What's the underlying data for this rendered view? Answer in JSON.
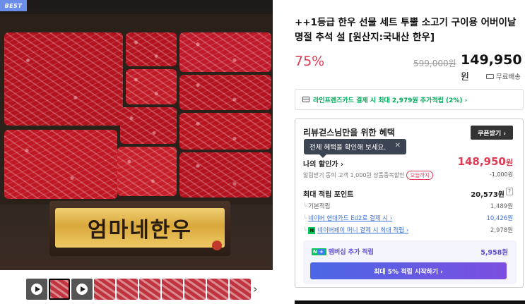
{
  "hero": {
    "badge": "BEST",
    "plaque_text": "엄마네한우"
  },
  "thumbnails": {
    "count": 10,
    "selected_index": 1,
    "video_indices": [
      0,
      2
    ],
    "next_label": "›"
  },
  "product": {
    "title": "++1등급 한우 선물 세트 투뿔 소고기 구이용 어버이날 명절 추석 설 [원산지:국내산 한우]",
    "discount_rate": "75%",
    "original_price": "599,000원",
    "sale_price": "149,950",
    "sale_unit": "원",
    "shipping": "무료배송"
  },
  "card_promo": {
    "text": "라인프렌즈카드 결제 시 최대 2,979원 추가적립 (2%) ›"
  },
  "benefit": {
    "heading": "리뷰걷스님만을 위한 혜택",
    "coupon_button": "쿠폰받기 ›",
    "tooltip": "전체 혜택을 확인해 보세요.",
    "tooltip_close": "✕",
    "my_price_label": "나의 할인가 ›",
    "my_price": "148,950",
    "my_price_unit": "원",
    "alarm_text": "알림받기 동의 고객 1,000원 상품중복할인",
    "alarm_tag": "오늘까지",
    "alarm_amount": "-1,000원",
    "points_label": "최대 적립 포인트",
    "points_total": "20,573원",
    "points_help": "?",
    "rows": [
      {
        "text": "기본적립",
        "amount": "1,489원",
        "link": false
      },
      {
        "text": "네이버 현대카드 Ed2로 결제 시 ›",
        "amount": "10,426원",
        "link": true
      },
      {
        "text": "네이버페이 머니 결제 시 최대 적립 ›",
        "amount": "2,978원",
        "link": true
      }
    ],
    "member_label": "멤버십 추가 적립",
    "member_badge_n": "N",
    "member_badge_plus": "+",
    "member_amount": "5,958원",
    "member_button": "최대 5% 적립 시작하기 ›"
  },
  "colors": {
    "discount": "#e03a54",
    "card_promo": "#00a85a",
    "link": "#3a6fd6",
    "membership": "#5a4ad6"
  }
}
